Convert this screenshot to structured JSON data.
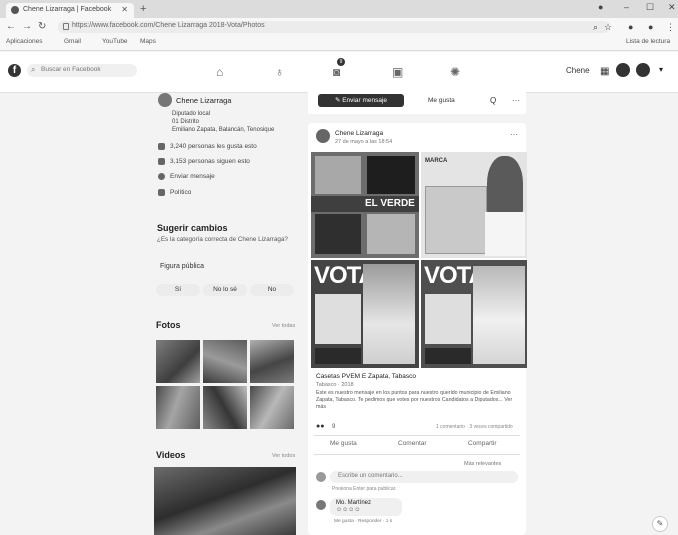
{
  "browser": {
    "tab_title": "Chene Lizarraga | Facebook",
    "new_tab": "+",
    "url": "https://www.facebook.com/Chene Lizarraga 2018-Vota/Photos",
    "bookmarks": [
      "Aplicaciones",
      "Gmail",
      "YouTube",
      "Maps"
    ],
    "reading_list": "Lista de lectura",
    "window_controls": [
      "–",
      "☐",
      "✕"
    ]
  },
  "facebook": {
    "logo": "f",
    "search_placeholder": "Buscar en Facebook",
    "notif_count": "9",
    "header_right_label": "Chene",
    "profile": {
      "name": "Chene Lizarraga",
      "role": "Diputado local",
      "district": "01 Distrito",
      "location": "Emiliano Zapata, Balancán, Tenosique",
      "likes": "3,240 personas les gusta esto",
      "followers": "3,153 personas siguen esto",
      "messenger": "Enviar mensaje",
      "category": "Político"
    },
    "suggest": {
      "title": "Sugerir cambios",
      "question": "¿Es la categoría correcta de Chene Lizarraga?",
      "category_value": "Figura pública",
      "options": [
        "Sí",
        "No lo sé",
        "No"
      ]
    },
    "photos": {
      "title": "Fotos",
      "see_all": "Ver todas"
    },
    "videos": {
      "title": "Videos",
      "see_all": "Ver todos"
    },
    "composer": {
      "send_message": "✎ Enviar mensaje",
      "like_button": "Me gusta",
      "search": "Q",
      "more": "···"
    },
    "post": {
      "author": "Chene Lizarraga",
      "date": "27 de mayo a las 18:54",
      "overlay_texts": [
        "EL VERDE",
        "VOTA",
        "VOTA",
        "MARCA"
      ],
      "caption_title": "Casetas PVEM E Zapata, Tabasco",
      "caption_sub": "Tabasco · 2018",
      "caption_body": "Este es nuestro mensaje en los puntos para nuestro querido municipio de Emiliano Zapata, Tabasco. Te pedimos que votes por nuestros Candidatos a Diputados... Ver más",
      "reactions_count": "9",
      "comments_shares": "1 comentario · 3 veces compartido",
      "actions": [
        "Me gusta",
        "Comentar",
        "Compartir"
      ],
      "relevance": "Más relevantes",
      "comment_placeholder": "Escribe un comentario...",
      "comment_hint": "Presiona Enter para publicar.",
      "commenter": "Mo. Martínez",
      "comment_actions": "Me gusta · Responder · 1 s"
    }
  }
}
